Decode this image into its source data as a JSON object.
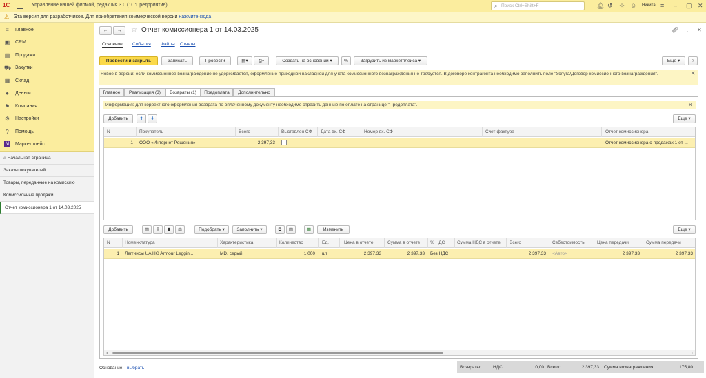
{
  "app": {
    "logo": "1С",
    "title": "Управление нашей фирмой, редакция 3.0  (1С:Предприятие)",
    "search_placeholder": "Поиск Ctrl+Shift+F",
    "user": "Никита"
  },
  "warning": {
    "text": "Эта версия для разработчиков. Для приобретения коммерческой версии ",
    "link": "нажмите сюда"
  },
  "sidebar": {
    "sections": [
      {
        "label": "Главное",
        "icon": "menu-icon"
      },
      {
        "label": "CRM",
        "icon": "crm-icon"
      },
      {
        "label": "Продажи",
        "icon": "sales-icon"
      },
      {
        "label": "Закупки",
        "icon": "purchases-icon"
      },
      {
        "label": "Склад",
        "icon": "warehouse-icon"
      },
      {
        "label": "Деньги",
        "icon": "money-icon"
      },
      {
        "label": "Компания",
        "icon": "flag-icon"
      },
      {
        "label": "Настройки",
        "icon": "gear-icon"
      },
      {
        "label": "Помощь",
        "icon": "help-icon"
      },
      {
        "label": "Маркетплейс",
        "icon": "marketplace-icon"
      }
    ],
    "history": [
      {
        "label": "Начальная страница"
      },
      {
        "label": "Заказы покупателей"
      },
      {
        "label": "Товары, переданные на комиссию"
      },
      {
        "label": "Комиссионные продажи"
      },
      {
        "label": "Отчет комиссионера 1 от 14.03.2025"
      }
    ]
  },
  "doc": {
    "title": "Отчет комиссионера 1 от 14.03.2025",
    "nav": {
      "main": "Основное",
      "events": "События",
      "files": "Файлы",
      "reports": "Отчеты"
    },
    "toolbar": {
      "post_close": "Провести и закрыть",
      "save": "Записать",
      "post": "Провести",
      "create_based": "Создать на основании",
      "load_marketplace": "Загрузить из маркетплейса",
      "more": "Еще"
    },
    "notice": "Новое в версии: если комиссионное вознаграждение не удерживается, оформление приходной накладной для учета комиссионного вознаграждения не требуется. В договоре контрагента необходимо заполнить поле \"Услуга/Договор комиссионного вознаграждения\".",
    "tabs": [
      {
        "label": "Главное"
      },
      {
        "label": "Реализация (3)"
      },
      {
        "label": "Возвраты (1)"
      },
      {
        "label": "Предоплата"
      },
      {
        "label": "Дополнительно"
      }
    ],
    "info": "Информация: для корректного оформления возврата по оплаченному документу необходимо отразить данные по оплате на странице \"Предоплата\".",
    "add_label": "Добавить",
    "more_label": "Еще",
    "returns": {
      "columns": [
        "N",
        "Покупатель",
        "Всего",
        "Выставлен СФ",
        "Дата вх. СФ",
        "Номер вх. СФ",
        "Счет-фактура",
        "Отчет комиссионера"
      ],
      "rows": [
        {
          "n": "1",
          "buyer": "ООО «Интернет Решения»",
          "total": "2 397,33",
          "sf": "",
          "date": "",
          "num": "",
          "invoice": "",
          "report": "Отчет комиссионера о продажах 1 от ..."
        }
      ]
    },
    "goods_toolbar": {
      "add": "Добавить",
      "select": "Подобрать",
      "fill": "Заполнить",
      "change": "Изменить",
      "more": "Еще"
    },
    "goods": {
      "columns": [
        "N",
        "Номенклатура",
        "Характеристика",
        "Количество",
        "Ед.",
        "Цена в отчете",
        "Сумма в отчете",
        "% НДС",
        "Сумма НДС в отчете",
        "Всего",
        "Себестоимость",
        "Цена передачи",
        "Сумма передачи"
      ],
      "rows": [
        {
          "n": "1",
          "item": "Леггинсы UA HG Armour Leggin...",
          "char": "MD, серый",
          "qty": "1,000",
          "unit": "шт",
          "price": "2 397,33",
          "sum": "2 397,33",
          "vat": "Без НДС",
          "vatsum": "",
          "total": "2 397,33",
          "cost": "<Авто>",
          "tprice": "2 397,33",
          "tsum": "2 397,33"
        }
      ]
    },
    "footer": {
      "basis_label": "Основание:",
      "basis_link": "выбрать",
      "returns_label": "Возвраты:",
      "vat_label": "НДС:",
      "vat_value": "0,00",
      "total_label": "Всего:",
      "total_value": "2 397,33",
      "reward_label": "Сумма вознаграждения:",
      "reward_value": "175,80"
    }
  }
}
